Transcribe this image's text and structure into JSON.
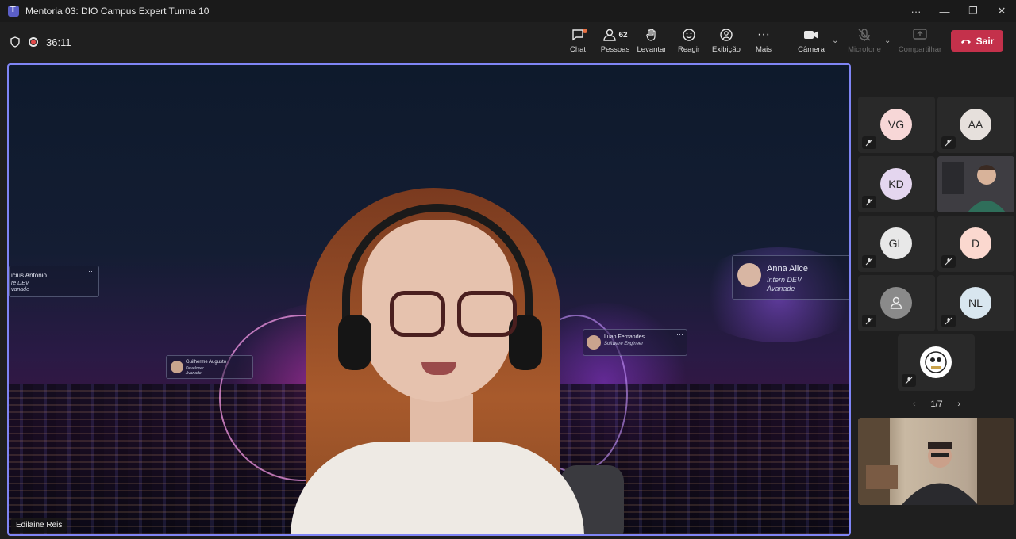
{
  "window": {
    "title": "Mentoria 03: DIO Campus Expert Turma 10",
    "controls": [
      "···",
      "—",
      "❐",
      "✕"
    ]
  },
  "toolbar": {
    "timer": "36:11",
    "buttons": [
      {
        "label": "Chat",
        "icon": "chat-icon"
      },
      {
        "label": "Pessoas",
        "icon": "people-icon",
        "count": "62"
      },
      {
        "label": "Levantar",
        "icon": "raise-hand-icon"
      },
      {
        "label": "Reagir",
        "icon": "smiley-icon"
      },
      {
        "label": "Exibição",
        "icon": "view-icon"
      },
      {
        "label": "Mais",
        "icon": "more-icon"
      },
      {
        "label": "Câmera",
        "icon": "camera-icon"
      },
      {
        "label": "Microfone",
        "icon": "microphone-icon"
      },
      {
        "label": "Compartilhar",
        "icon": "share-icon"
      }
    ],
    "leave_label": "Sair",
    "leave_color": "#c4314b"
  },
  "stage": {
    "speaker_name": "Edilaine Reis",
    "background_cards": [
      {
        "name": "icius Antonio",
        "role": "re DEV\nvanade"
      },
      {
        "name": "Guilherme Augusto",
        "role": "Developer\nAvanade"
      },
      {
        "name": "Luan Fernandes",
        "role": "Software Engineer"
      },
      {
        "name": "Anna Alice",
        "role": "Intern DEV",
        "company": "Avanade"
      }
    ]
  },
  "participants": {
    "tiles": [
      {
        "initials": "VG",
        "color": "#f7d7d7"
      },
      {
        "initials": "AA",
        "color": "#e6e0dc"
      },
      {
        "initials": "KD",
        "color": "#e4d6ef"
      },
      {
        "initials": "",
        "video": true
      },
      {
        "initials": "GL",
        "color": "#e8e8e8"
      },
      {
        "initials": "D",
        "color": "#fbd8cf"
      },
      {
        "initials": "",
        "icon": "person-icon",
        "color": "#8a8a8a"
      },
      {
        "initials": "NL",
        "color": "#d8e6ef"
      },
      {
        "initials": "",
        "icon": "avatar-image-icon",
        "color": "#ffffff"
      }
    ],
    "page_label": "1/7"
  },
  "accent_color": "#7f85f5"
}
